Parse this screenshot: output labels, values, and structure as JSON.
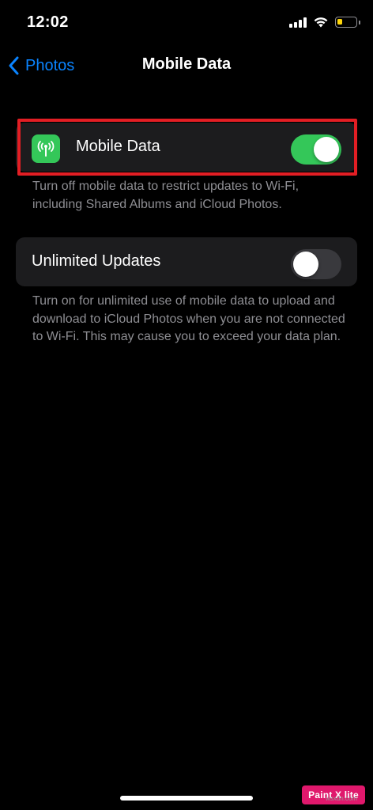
{
  "status_bar": {
    "time": "12:02",
    "battery_level": 0.25,
    "battery_color": "#ffd60a",
    "icons": [
      "cellular-signal-icon",
      "wifi-icon",
      "battery-icon"
    ]
  },
  "nav": {
    "back_label": "Photos",
    "title": "Mobile Data",
    "back_icon": "chevron-left-icon"
  },
  "mobile_data_row": {
    "label": "Mobile Data",
    "icon": "antenna-icon",
    "icon_color": "#34c759",
    "toggle_state": "on",
    "toggle_color": "#34c759"
  },
  "mobile_data_footer": "Turn off mobile data to restrict updates to Wi-Fi, including Shared Albums and iCloud Photos.",
  "unlimited_updates_row": {
    "label": "Unlimited Updates",
    "toggle_state": "off",
    "toggle_color": "#39393d"
  },
  "unlimited_updates_footer": "Turn on for unlimited use of mobile data to upload and download to iCloud Photos when you are not connected to Wi-Fi. This may cause you to exceed your data plan.",
  "highlight_color": "#e21e24",
  "watermark": {
    "label": "Paint X lite",
    "sub": "wsxdn.com"
  }
}
